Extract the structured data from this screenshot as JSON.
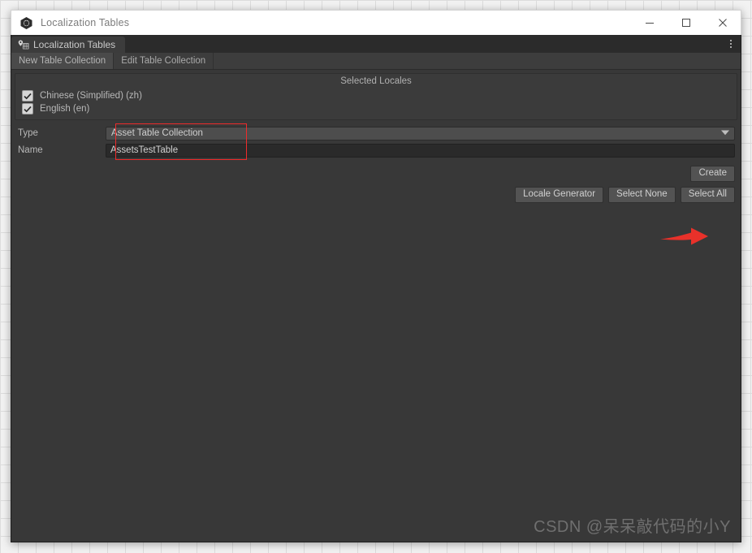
{
  "window": {
    "title": "Localization Tables",
    "icon": "unity-cube-icon",
    "controls": {
      "minimize": "minimize-icon",
      "maximize": "maximize-icon",
      "close": "close-icon"
    }
  },
  "tabstrip": {
    "tab_label": "Localization Tables",
    "tab_icon": "locale-table-icon",
    "menu_icon": "kebab-menu-icon"
  },
  "subtabs": [
    {
      "label": "New Table Collection",
      "active": true
    },
    {
      "label": "Edit Table Collection",
      "active": false
    }
  ],
  "locales": {
    "header": "Selected Locales",
    "items": [
      {
        "label": "Chinese (Simplified) (zh)",
        "checked": true
      },
      {
        "label": "English (en)",
        "checked": true
      }
    ]
  },
  "form": {
    "type": {
      "label": "Type",
      "value": "Asset Table Collection",
      "caret_icon": "chevron-down-icon"
    },
    "name": {
      "label": "Name",
      "value": "AssetsTestTable",
      "placeholder": ""
    }
  },
  "buttons": {
    "create": "Create",
    "locale_generator": "Locale Generator",
    "select_none": "Select None",
    "select_all": "Select All"
  },
  "annotations": {
    "arrow_color": "#e8312a",
    "highlight_color": "#ef2b2b"
  },
  "watermark": "CSDN @呆呆敲代码的小Y"
}
